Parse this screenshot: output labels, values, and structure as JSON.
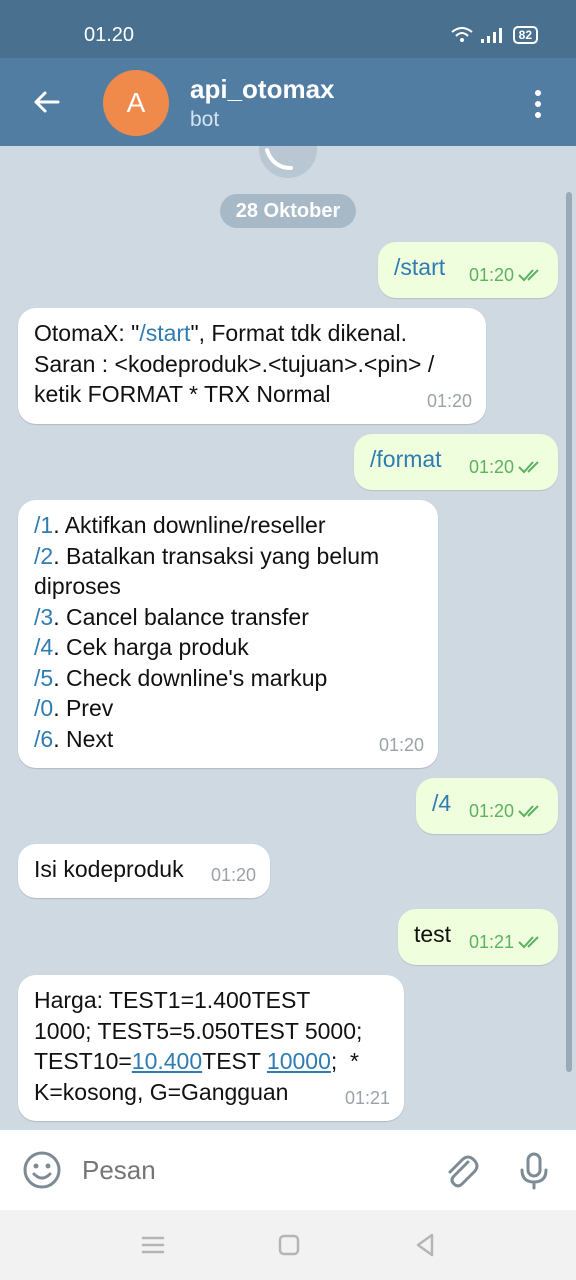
{
  "status_bar": {
    "time": "01.20",
    "battery": "82"
  },
  "header": {
    "avatar_letter": "A",
    "title": "api_otomax",
    "subtitle": "bot"
  },
  "chat": {
    "date_chip": "28 Oktober",
    "messages": [
      {
        "dir": "out",
        "text": "/start",
        "time": "01:20",
        "status": "read"
      },
      {
        "dir": "in",
        "text_before": "OtomaX: \"",
        "command": "/start",
        "text_after": "\", Format tdk dikenal.",
        "line2": "Saran : <kodeproduk>.<tujuan>.<pin> /",
        "line3": "ketik FORMAT * TRX Normal",
        "time": "01:20"
      },
      {
        "dir": "out",
        "text": "/format",
        "time": "01:20",
        "status": "read"
      },
      {
        "dir": "in",
        "items": [
          {
            "cmd": "/1",
            "label": ". Aktifkan downline/reseller"
          },
          {
            "cmd": "/2",
            "label": ". Batalkan transaksi yang belum"
          },
          {
            "cmd": "",
            "label": "diproses"
          },
          {
            "cmd": "/3",
            "label": ". Cancel balance transfer"
          },
          {
            "cmd": "/4",
            "label": ". Cek harga produk"
          },
          {
            "cmd": "/5",
            "label": ". Check downline's markup"
          },
          {
            "cmd": "/0",
            "label": ". Prev"
          },
          {
            "cmd": "/6",
            "label": ". Next"
          }
        ],
        "time": "01:20"
      },
      {
        "dir": "out",
        "text": "/4",
        "time": "01:20",
        "status": "read"
      },
      {
        "dir": "in",
        "text": "Isi kodeproduk",
        "time": "01:20"
      },
      {
        "dir": "out",
        "text": "test",
        "time": "01:21",
        "status": "read"
      },
      {
        "dir": "in",
        "line1": "Harga: TEST1=1.400TEST",
        "line2": "1000; TEST5=5.050TEST 5000;",
        "line3_a": "TEST10=",
        "line3_link1": "10.400",
        "line3_b": "TEST ",
        "line3_link2": "10000",
        "line3_c": ";  *",
        "line4": "K=kosong, G=Gangguan",
        "time": "01:21"
      }
    ]
  },
  "input": {
    "placeholder": "Pesan"
  },
  "colors": {
    "header": "#527da3",
    "status_bar": "#49708f",
    "outgoing_bubble": "#effedd",
    "incoming_bubble": "#ffffff",
    "link": "#2f7cb3",
    "avatar": "#f08a4b"
  }
}
